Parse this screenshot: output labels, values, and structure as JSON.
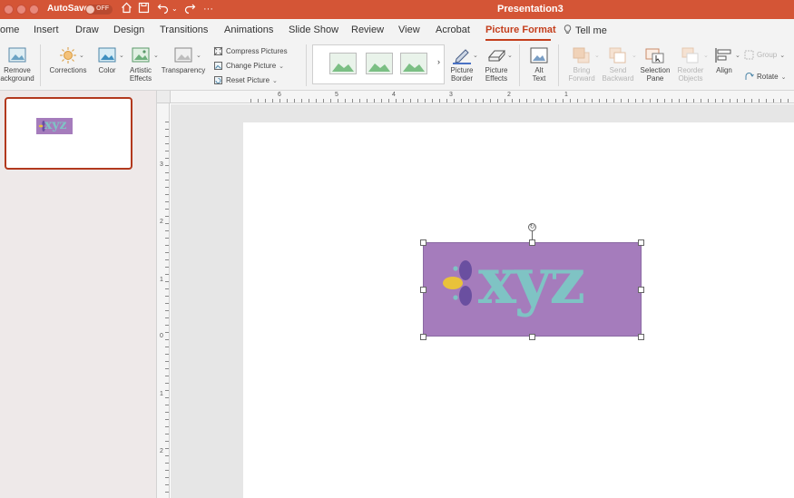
{
  "titlebar": {
    "autosave_label": "AutoSave",
    "autosave_state": "OFF",
    "more_label": "···",
    "document_title": "Presentation3",
    "color": "#d45536"
  },
  "tabs": [
    {
      "label": "ome"
    },
    {
      "label": "Insert"
    },
    {
      "label": "Draw"
    },
    {
      "label": "Design"
    },
    {
      "label": "Transitions"
    },
    {
      "label": "Animations"
    },
    {
      "label": "Slide Show"
    },
    {
      "label": "Review"
    },
    {
      "label": "View"
    },
    {
      "label": "Acrobat"
    },
    {
      "label": "Picture Format",
      "active": true
    },
    {
      "label": "Tell me"
    }
  ],
  "ribbon": {
    "remove_background": [
      "Remove",
      "ackground"
    ],
    "corrections": "Corrections",
    "color": "Color",
    "artistic_effects": [
      "Artistic",
      "Effects"
    ],
    "transparency": "Transparency",
    "compress_pictures": "Compress Pictures",
    "change_picture": "Change Picture",
    "reset_picture": "Reset Picture",
    "picture_border": [
      "Picture",
      "Border"
    ],
    "picture_effects": [
      "Picture",
      "Effects"
    ],
    "alt_text": [
      "Alt",
      "Text"
    ],
    "bring_forward": [
      "Bring",
      "Forward"
    ],
    "send_backward": [
      "Send",
      "Backward"
    ],
    "selection_pane": [
      "Selection",
      "Pane"
    ],
    "reorder_objects": [
      "Reorder",
      "Objects"
    ],
    "align": "Align",
    "group": "Group",
    "rotate": "Rotate"
  },
  "rulers": {
    "top": [
      "6",
      "5",
      "4",
      "3",
      "2",
      "1"
    ],
    "left": [
      "3",
      "2",
      "1",
      "0",
      "1",
      "2"
    ]
  },
  "thumbnail": {
    "logo_text": "xyz"
  },
  "slide": {
    "logo_text": "xyz",
    "logo_background": "#a57cbc",
    "logo_text_color": "#7fc3c4",
    "petal_color": "#6a4fa0",
    "center_color": "#e9c23a"
  },
  "colors": {
    "accent": "#c43e1c",
    "thumb_border": "#b2391e"
  }
}
